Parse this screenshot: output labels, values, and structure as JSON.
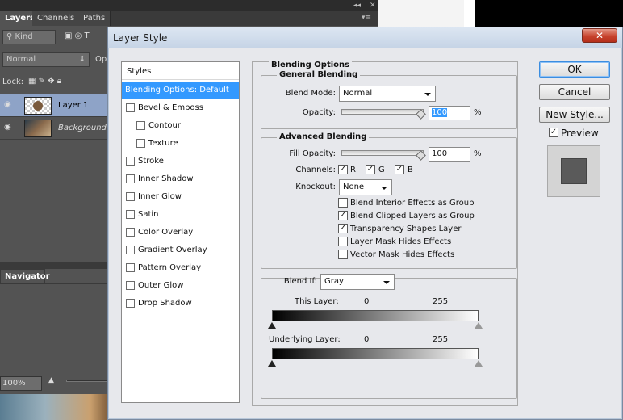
{
  "panels": {
    "tabs": [
      "Layers",
      "Channels",
      "Paths"
    ],
    "kind_label": "Kind",
    "blend_value": "Normal",
    "blend_suffix": "Op",
    "lock_label": "Lock:",
    "layers": [
      {
        "name": "Layer 1",
        "selected": true
      },
      {
        "name": "Background",
        "selected": false
      }
    ],
    "navigator_tab": "Navigator",
    "zoom": "100%"
  },
  "dialog": {
    "title": "Layer Style",
    "close_glyph": "✕",
    "styles_header": "Styles",
    "styles_items": [
      {
        "label": "Blending Options: Default",
        "selected": true,
        "checkbox": false,
        "indent": false
      },
      {
        "label": "Bevel & Emboss",
        "checkbox": true,
        "indent": false
      },
      {
        "label": "Contour",
        "checkbox": true,
        "indent": true
      },
      {
        "label": "Texture",
        "checkbox": true,
        "indent": true
      },
      {
        "label": "Stroke",
        "checkbox": true,
        "indent": false
      },
      {
        "label": "Inner Shadow",
        "checkbox": true,
        "indent": false
      },
      {
        "label": "Inner Glow",
        "checkbox": true,
        "indent": false
      },
      {
        "label": "Satin",
        "checkbox": true,
        "indent": false
      },
      {
        "label": "Color Overlay",
        "checkbox": true,
        "indent": false
      },
      {
        "label": "Gradient Overlay",
        "checkbox": true,
        "indent": false
      },
      {
        "label": "Pattern Overlay",
        "checkbox": true,
        "indent": false
      },
      {
        "label": "Outer Glow",
        "checkbox": true,
        "indent": false
      },
      {
        "label": "Drop Shadow",
        "checkbox": true,
        "indent": false
      }
    ],
    "blending_options_title": "Blending Options",
    "general": {
      "title": "General Blending",
      "blend_mode_label": "Blend Mode:",
      "blend_mode_value": "Normal",
      "opacity_label": "Opacity:",
      "opacity_value": "100",
      "opacity_unit": "%"
    },
    "advanced": {
      "title": "Advanced Blending",
      "fill_opacity_label": "Fill Opacity:",
      "fill_opacity_value": "100",
      "fill_unit": "%",
      "channels_label": "Channels:",
      "channels": [
        {
          "label": "R",
          "checked": true
        },
        {
          "label": "G",
          "checked": true
        },
        {
          "label": "B",
          "checked": true
        }
      ],
      "knockout_label": "Knockout:",
      "knockout_value": "None",
      "options": [
        {
          "label": "Blend Interior Effects as Group",
          "checked": false
        },
        {
          "label": "Blend Clipped Layers as Group",
          "checked": true
        },
        {
          "label": "Transparency Shapes Layer",
          "checked": true
        },
        {
          "label": "Layer Mask Hides Effects",
          "checked": false
        },
        {
          "label": "Vector Mask Hides Effects",
          "checked": false
        }
      ]
    },
    "blend_if": {
      "label": "Blend If:",
      "value": "Gray",
      "this_layer_label": "This Layer:",
      "this_min": "0",
      "this_max": "255",
      "underlying_label": "Underlying Layer:",
      "under_min": "0",
      "under_max": "255"
    },
    "buttons": {
      "ok": "OK",
      "cancel": "Cancel",
      "new_style": "New Style..."
    },
    "preview_label": "Preview",
    "preview_checked": true,
    "check_glyph": "✓"
  }
}
